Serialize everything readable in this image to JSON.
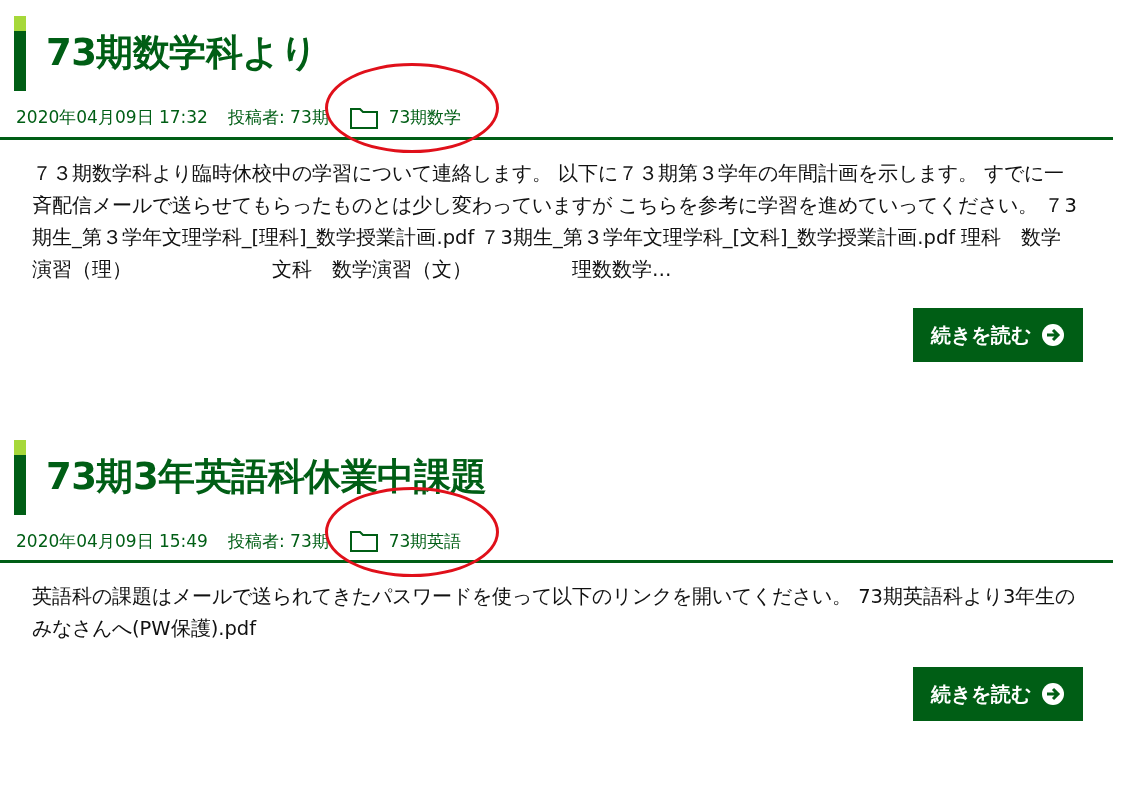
{
  "posts": [
    {
      "title": "73期数学科より",
      "date": "2020年04月09日 17:32",
      "author": "投稿者: 73期",
      "category": "73期数学",
      "category_highlighted": true,
      "excerpt": "７３期数学科より臨時休校中の学習について連絡します。 以下に７３期第３学年の年間計画を示します。 すでに一斉配信メールで送らせてもらったものとは少し変わっていますが こちらを参考に学習を進めていってください。 ７3期生_第３学年文理学科_[理科]_数学授業計画.pdf ７3期生_第３学年文理学科_[文科]_数学授業計画.pdf 理科　数学演習（理）　　　　　　　文科　数学演習（文）　　　　　理数数学…",
      "button": "続きを読む"
    },
    {
      "title": "73期3年英語科休業中課題",
      "date": "2020年04月09日 15:49",
      "author": "投稿者: 73期",
      "category": "73期英語",
      "category_highlighted": true,
      "excerpt": "英語科の課題はメールで送られてきたパスワードを使って以下のリンクを開いてください。 73期英語科より3年生のみなさんへ(PW保護).pdf",
      "button": "続きを読む"
    }
  ]
}
